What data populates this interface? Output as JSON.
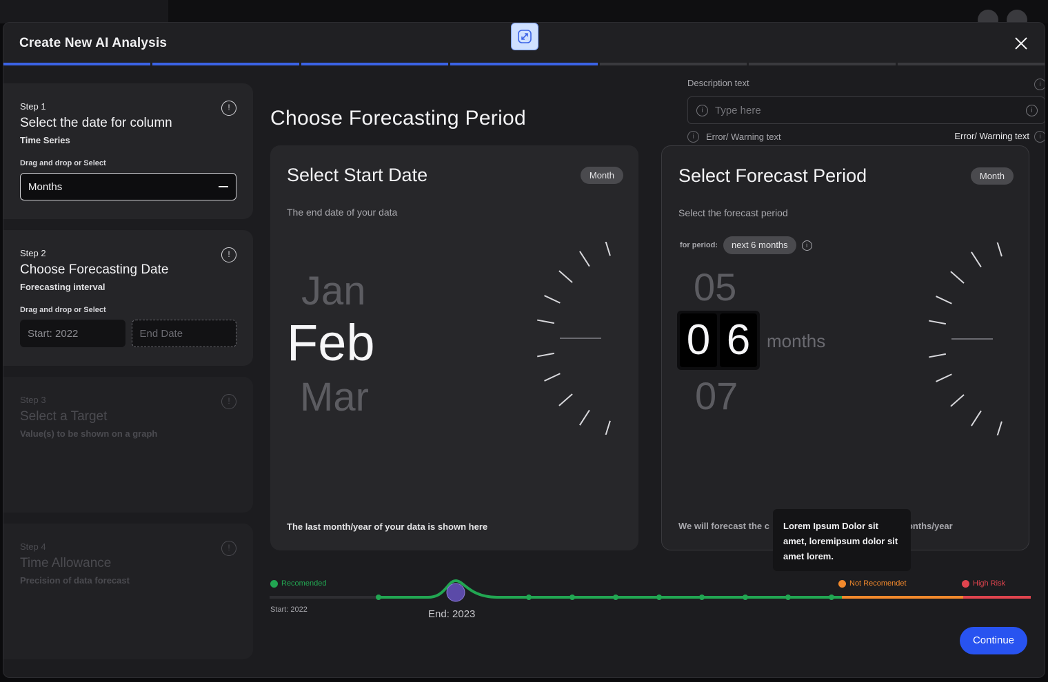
{
  "modal": {
    "title": "Create New AI Analysis",
    "progress": {
      "total_segments": 7,
      "completed_segments": 4
    }
  },
  "steps": [
    {
      "num": "Step 1",
      "title": "Select the date for column",
      "sub": "Time Series",
      "dd_label": "Drag and drop or Select",
      "field_value": "Months"
    },
    {
      "num": "Step 2",
      "title": "Choose Forecasting Date",
      "sub": "Forecasting interval",
      "dd_label": "Drag and drop or Select",
      "start_value": "Start: 2022",
      "end_placeholder": "End Date"
    },
    {
      "num": "Step 3",
      "title": "Select a Target",
      "sub": "Value(s) to be shown on a graph"
    },
    {
      "num": "Step 4",
      "title": "Time Allowance",
      "sub": "Precision of data forecast"
    }
  ],
  "main": {
    "title": "Choose Forecasting Period"
  },
  "description": {
    "label": "Description text",
    "placeholder": "Type here",
    "error_left": "Error/ Warning text",
    "error_right": "Error/ Warning text"
  },
  "start_card": {
    "title": "Select Start Date",
    "pill": "Month",
    "subtitle": "The end date of your data",
    "prev": "Jan",
    "current": "Feb",
    "next": "Mar",
    "footer": "The last month/year of your data is shown here"
  },
  "forecast_card": {
    "title": "Select Forecast Period",
    "pill": "Month",
    "subtitle": "Select the forecast period",
    "period_label": "for period:",
    "period_value": "next 6 months",
    "prev": "05",
    "current_d1": "0",
    "current_d2": "6",
    "next": "07",
    "unit": "months",
    "footer": "We will forecast the c",
    "footer_tail": "onths/year"
  },
  "tooltip": {
    "text": "Lorem Ipsum Dolor sit amet, loremipsum dolor sit amet lorem."
  },
  "timeline": {
    "legend_recommended": "Recomended",
    "legend_not_recommended": "Not Recomendet",
    "legend_high_risk": "High Risk",
    "start_label": "Start: 2022",
    "end_label": "End: 2023",
    "colors": {
      "recommended": "#22a652",
      "not_recommended": "#f2892c",
      "high_risk": "#e0444e",
      "inactive": "#2e2e32"
    }
  },
  "actions": {
    "continue": "Continue"
  }
}
